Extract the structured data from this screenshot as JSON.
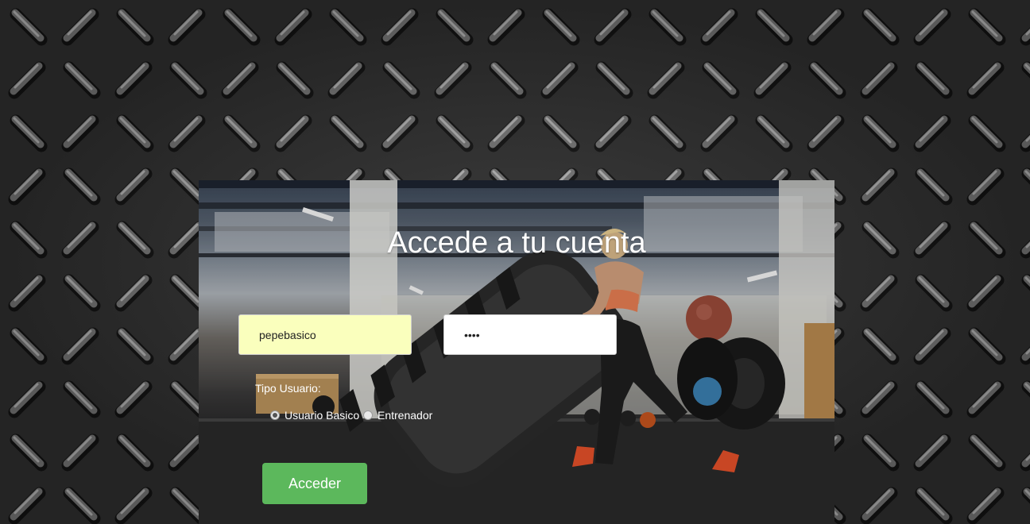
{
  "login": {
    "title": "Accede a tu cuenta",
    "username_value": "pepebasico",
    "password_value": "••••",
    "tipo_label": "Tipo Usuario:",
    "radio_basico_label": "Usuario Basico",
    "radio_entrenador_label": "Entrenador",
    "selected_type": "Usuario Basico",
    "submit_label": "Acceder"
  },
  "colors": {
    "username_bg": "#faffbd",
    "button_green": "#5cb85c"
  }
}
